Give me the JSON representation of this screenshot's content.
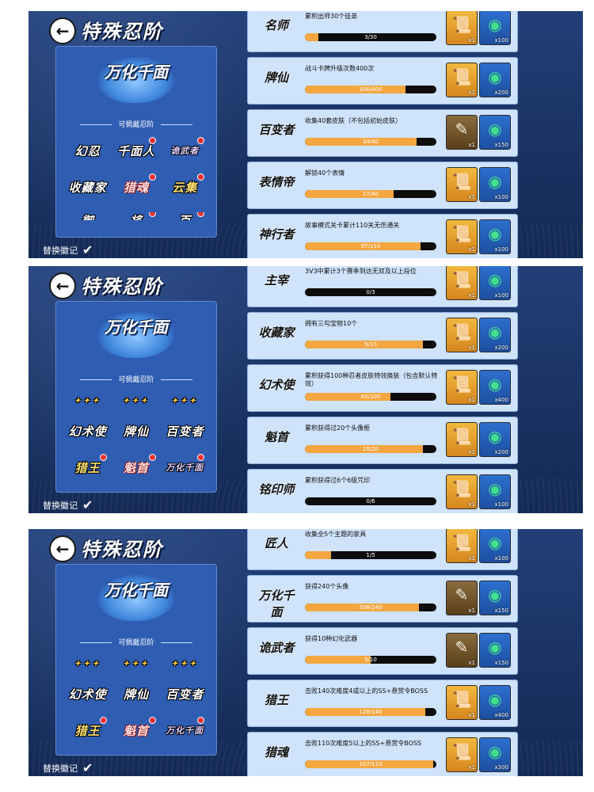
{
  "panels": [
    {
      "title": "特殊忍阶",
      "back_icon": "back-arrow-icon",
      "emblem": "万化千面",
      "wearable_label": "可佩戴忍阶",
      "replace_label": "替换徽记",
      "badges": [
        {
          "label": "幻忍",
          "dot": false,
          "style": "plain"
        },
        {
          "label": "千面人",
          "dot": true,
          "style": "plain"
        },
        {
          "label": "诡武者",
          "dot": true,
          "style": "purple"
        },
        {
          "label": "收藏家",
          "dot": false,
          "style": "plain"
        },
        {
          "label": "猎魂",
          "dot": true,
          "style": "red"
        },
        {
          "label": "云集",
          "dot": true,
          "style": "gold"
        },
        {
          "label": "御",
          "dot": false,
          "style": "clip"
        },
        {
          "label": "将",
          "dot": true,
          "style": "clip"
        },
        {
          "label": "百",
          "dot": true,
          "style": "clip"
        }
      ],
      "rows": [
        {
          "name": "名师",
          "desc": "累积出师30个徒弟",
          "progress": "3/30",
          "ratio": 0.1,
          "reward1": "x1",
          "reward1_kind": "scroll-gold",
          "reward2": "x100"
        },
        {
          "name": "牌仙",
          "desc": "战斗卡牌升级次数400次",
          "progress": "306/400",
          "ratio": 0.765,
          "reward1": "x1",
          "reward1_kind": "scroll-gold",
          "reward2": "x200"
        },
        {
          "name": "百变者",
          "desc": "收集40套皮肤（不包括初始皮肤）",
          "progress": "34/40",
          "ratio": 0.85,
          "reward1": "x1",
          "reward1_kind": "scroll-s",
          "reward2": "x150"
        },
        {
          "name": "表情帝",
          "desc": "解锁40个表情",
          "progress": "27/40",
          "ratio": 0.675,
          "reward1": "x1",
          "reward1_kind": "scroll-gold",
          "reward2": "x100"
        },
        {
          "name": "神行者",
          "desc": "故事模式关卡累计110关无伤通关",
          "progress": "97/110",
          "ratio": 0.88,
          "reward1": "x1",
          "reward1_kind": "scroll-gold",
          "reward2": "x100"
        }
      ]
    },
    {
      "title": "特殊忍阶",
      "back_icon": "back-arrow-icon",
      "emblem": "万化千面",
      "wearable_label": "可佩戴忍阶",
      "replace_label": "替换徽记",
      "badges": [
        {
          "label": "✦✦✦",
          "dot": false,
          "style": "cut"
        },
        {
          "label": "✦✦✦",
          "dot": false,
          "style": "cut"
        },
        {
          "label": "✦✦✦",
          "dot": false,
          "style": "cut"
        },
        {
          "label": "幻术使",
          "dot": false,
          "style": "plain"
        },
        {
          "label": "牌仙",
          "dot": false,
          "style": "plain"
        },
        {
          "label": "百变者",
          "dot": false,
          "style": "plain"
        },
        {
          "label": "猎王",
          "dot": true,
          "style": "gold"
        },
        {
          "label": "魁首",
          "dot": true,
          "style": "red"
        },
        {
          "label": "万化千面",
          "dot": true,
          "style": "purple"
        }
      ],
      "rows": [
        {
          "name": "主宰",
          "desc": "3V3中累计3个赛季到达无双及以上段位",
          "progress": "0/3",
          "ratio": 0,
          "reward1": "x1",
          "reward1_kind": "scroll-gold",
          "reward2": "x100"
        },
        {
          "name": "收藏家",
          "desc": "拥有三勾宝物10个",
          "progress": "9/10",
          "ratio": 0.9,
          "reward1": "x1",
          "reward1_kind": "scroll-gold",
          "reward2": "x200"
        },
        {
          "name": "幻术使",
          "desc": "累积获得100种忍者皮肤特效换装（包含默认特效）",
          "progress": "65/100",
          "ratio": 0.65,
          "reward1": "x1",
          "reward1_kind": "scroll-gold",
          "reward2": "x400"
        },
        {
          "name": "魁首",
          "desc": "累积获得过20个头像框",
          "progress": "18/20",
          "ratio": 0.9,
          "reward1": "x1",
          "reward1_kind": "scroll-gold",
          "reward2": "x200"
        },
        {
          "name": "铭印师",
          "desc": "累积获得过6个6级咒印",
          "progress": "0/6",
          "ratio": 0,
          "reward1": "x1",
          "reward1_kind": "scroll-gold",
          "reward2": "x100"
        }
      ]
    },
    {
      "title": "特殊忍阶",
      "back_icon": "back-arrow-icon",
      "emblem": "万化千面",
      "wearable_label": "可佩戴忍阶",
      "replace_label": "替换徽记",
      "badges": [
        {
          "label": "✦✦✦",
          "dot": false,
          "style": "cut"
        },
        {
          "label": "✦✦✦",
          "dot": false,
          "style": "cut"
        },
        {
          "label": "✦✦✦",
          "dot": false,
          "style": "cut"
        },
        {
          "label": "幻术使",
          "dot": false,
          "style": "plain"
        },
        {
          "label": "牌仙",
          "dot": false,
          "style": "plain"
        },
        {
          "label": "百变者",
          "dot": false,
          "style": "plain"
        },
        {
          "label": "猎王",
          "dot": true,
          "style": "gold"
        },
        {
          "label": "魁首",
          "dot": true,
          "style": "red"
        },
        {
          "label": "万化千面",
          "dot": true,
          "style": "purple"
        }
      ],
      "rows": [
        {
          "name": "匠人",
          "desc": "收集全5个主题的家具",
          "progress": "1/5",
          "ratio": 0.2,
          "reward1": "x1",
          "reward1_kind": "scroll-gold",
          "reward2": "x100"
        },
        {
          "name": "万化千面",
          "desc": "获得240个头像",
          "progress": "208/240",
          "ratio": 0.867,
          "reward1": "x1",
          "reward1_kind": "scroll-s",
          "reward2": "x150"
        },
        {
          "name": "诡武者",
          "desc": "获得10种幻化武器",
          "progress": "5/10",
          "ratio": 0.5,
          "reward1": "x1",
          "reward1_kind": "scroll-s",
          "reward2": "x150"
        },
        {
          "name": "猎王",
          "desc": "击败140次难度4或以上的SS+悬赏令BOSS",
          "progress": "128/140",
          "ratio": 0.914,
          "reward1": "x1",
          "reward1_kind": "scroll-gold",
          "reward2": "x400"
        },
        {
          "name": "猎魂",
          "desc": "击败110次难度5以上的SS+悬赏令BOSS",
          "progress": "107/110",
          "ratio": 0.973,
          "reward1": "x1",
          "reward1_kind": "scroll-gold",
          "reward2": "x300"
        }
      ]
    }
  ]
}
